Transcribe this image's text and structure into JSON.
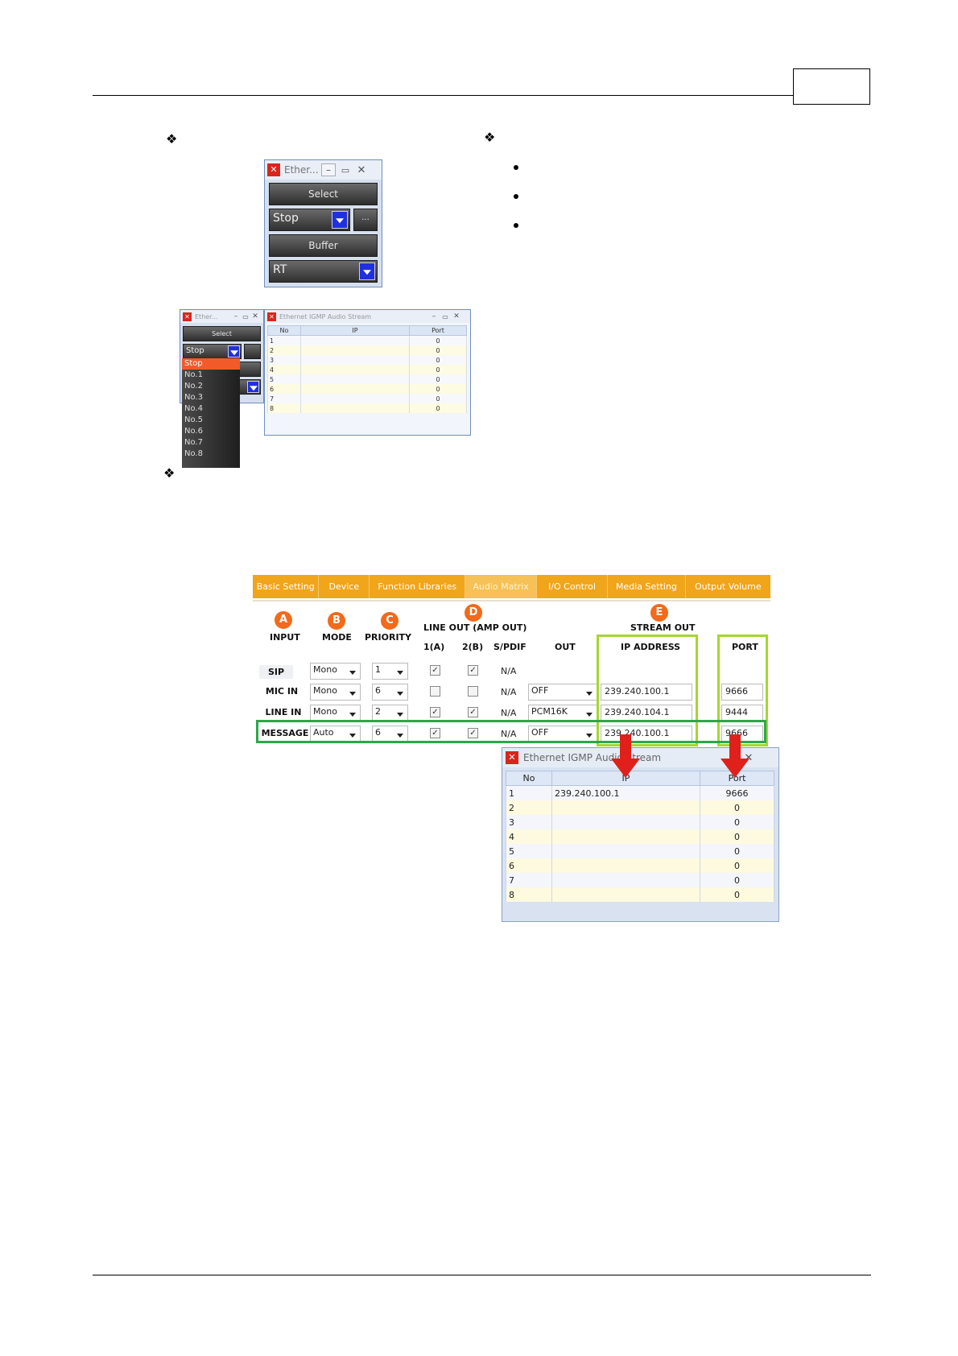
{
  "widget_small": {
    "title": "Ether...",
    "select_label": "Select",
    "stop_value": "Stop",
    "more_label": "...",
    "buffer_label": "Buffer",
    "rt_value": "RT"
  },
  "widget_popup": {
    "title": "Ether...",
    "select_label": "Select",
    "stop_value": "Stop",
    "options": [
      "Stop",
      "No.1",
      "No.2",
      "No.3",
      "No.4",
      "No.5",
      "No.6",
      "No.7",
      "No.8"
    ]
  },
  "stream_small": {
    "title": "Ethernet IGMP Audio Stream",
    "columns": [
      "No",
      "IP",
      "Port"
    ],
    "rows": [
      {
        "no": "1",
        "ip": "",
        "port": "0"
      },
      {
        "no": "2",
        "ip": "",
        "port": "0"
      },
      {
        "no": "3",
        "ip": "",
        "port": "0"
      },
      {
        "no": "4",
        "ip": "",
        "port": "0"
      },
      {
        "no": "5",
        "ip": "",
        "port": "0"
      },
      {
        "no": "6",
        "ip": "",
        "port": "0"
      },
      {
        "no": "7",
        "ip": "",
        "port": "0"
      },
      {
        "no": "8",
        "ip": "",
        "port": "0"
      }
    ]
  },
  "tabs": [
    "Basic Setting",
    "Device",
    "Function Libraries",
    "Audio Matrix",
    "I/O Control",
    "Media Setting",
    "Output Volume"
  ],
  "matrix": {
    "circles": [
      "A",
      "B",
      "C",
      "D",
      "E"
    ],
    "headers": {
      "input": "INPUT",
      "mode": "MODE",
      "priority": "PRIORITY",
      "line_out": "LINE OUT (AMP OUT)",
      "stream_out": "STREAM OUT",
      "col_1a": "1(A)",
      "col_2b": "2(B)",
      "col_spdif": "S/PDIF",
      "col_out": "OUT",
      "col_ip": "IP ADDRESS",
      "col_port": "PORT"
    },
    "rows": [
      {
        "input": "SIP",
        "mode": "Mono",
        "priority": "1",
        "a": "✓",
        "b": "✓",
        "spdif": "N/A",
        "out": "",
        "ip": "",
        "port": ""
      },
      {
        "input": "MIC IN",
        "mode": "Mono",
        "priority": "6",
        "a": "",
        "b": "",
        "spdif": "N/A",
        "out": "OFF",
        "ip": "239.240.100.1",
        "port": "9666"
      },
      {
        "input": "LINE IN",
        "mode": "Mono",
        "priority": "2",
        "a": "✓",
        "b": "✓",
        "spdif": "N/A",
        "out": "PCM16K",
        "ip": "239.240.104.1",
        "port": "9444"
      },
      {
        "input": "MESSAGE",
        "mode": "Auto",
        "priority": "6",
        "a": "✓",
        "b": "✓",
        "spdif": "N/A",
        "out": "OFF",
        "ip": "239.240.100.1",
        "port": "9666"
      }
    ]
  },
  "stream_big": {
    "title": "Ethernet IGMP Audio Stream",
    "columns": [
      "No",
      "IP",
      "Port"
    ],
    "rows": [
      {
        "no": "1",
        "ip": "239.240.100.1",
        "port": "9666"
      },
      {
        "no": "2",
        "ip": "",
        "port": "0"
      },
      {
        "no": "3",
        "ip": "",
        "port": "0"
      },
      {
        "no": "4",
        "ip": "",
        "port": "0"
      },
      {
        "no": "5",
        "ip": "",
        "port": "0"
      },
      {
        "no": "6",
        "ip": "",
        "port": "0"
      },
      {
        "no": "7",
        "ip": "",
        "port": "0"
      },
      {
        "no": "8",
        "ip": "",
        "port": "0"
      }
    ]
  },
  "colors": {
    "tab_orange": "#f1a51a",
    "circle_orange": "#f26a1b",
    "frame_lime": "#a6d62f",
    "frame_green": "#2aa84a",
    "arrow_red": "#e0201b"
  }
}
